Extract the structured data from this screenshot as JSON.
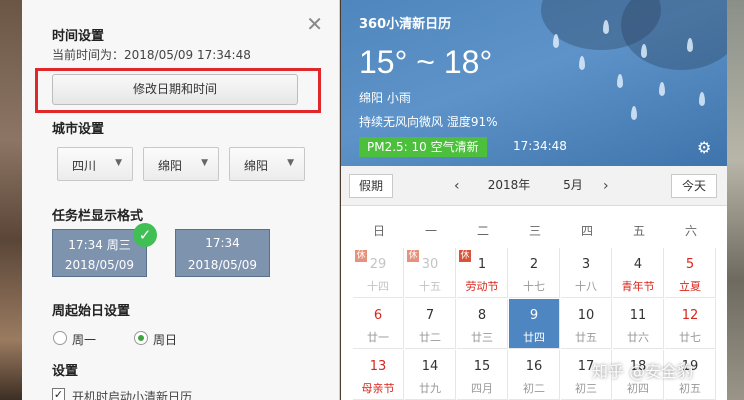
{
  "settings": {
    "time_section_title": "时间设置",
    "current_time_label": "当前时间为：2018/05/09 17:34:48",
    "modify_button": "修改日期和时间",
    "city_section_title": "城市设置",
    "city_selects": [
      "四川",
      "绵阳",
      "绵阳"
    ],
    "taskbar_section_title": "任务栏显示格式",
    "format_options": [
      {
        "line1": "17:34 周三",
        "line2": "2018/05/09",
        "selected": true
      },
      {
        "line1": "17:34",
        "line2": "2018/05/09",
        "selected": false
      }
    ],
    "week_start_title": "周起始日设置",
    "week_start_options": [
      {
        "label": "周一",
        "selected": false
      },
      {
        "label": "周日",
        "selected": true
      }
    ],
    "settings_title": "设置",
    "autostart_label": "开机时启动小清新日历"
  },
  "weather": {
    "app_title": "360小清新日历",
    "temperature": "15° ~ 18°",
    "location_condition": "绵阳 小雨",
    "wind_humidity": "持续无风向微风 湿度91%",
    "pm25": "PM2.5: 10 空气清新",
    "time": "17:34:48"
  },
  "toolbar": {
    "holiday_button": "假期",
    "year": "2018年",
    "month": "5月",
    "today_button": "今天"
  },
  "weekdays": [
    "日",
    "一",
    "二",
    "三",
    "四",
    "五",
    "六"
  ],
  "days": [
    {
      "day": "29",
      "lunar": "十四",
      "dim": true,
      "red": false,
      "tag": "休"
    },
    {
      "day": "30",
      "lunar": "十五",
      "dim": true,
      "red": false,
      "tag": "休"
    },
    {
      "day": "1",
      "lunar": "劳动节",
      "dim": false,
      "red": false,
      "lunar_red": true,
      "tag": "休"
    },
    {
      "day": "2",
      "lunar": "十七",
      "dim": false,
      "red": false
    },
    {
      "day": "3",
      "lunar": "十八",
      "dim": false,
      "red": false
    },
    {
      "day": "4",
      "lunar": "青年节",
      "dim": false,
      "red": false,
      "lunar_red": true
    },
    {
      "day": "5",
      "lunar": "立夏",
      "dim": false,
      "red": true,
      "lunar_red": true
    },
    {
      "day": "6",
      "lunar": "廿一",
      "dim": false,
      "red": true
    },
    {
      "day": "7",
      "lunar": "廿二",
      "dim": false,
      "red": false
    },
    {
      "day": "8",
      "lunar": "廿三",
      "dim": false,
      "red": false
    },
    {
      "day": "9",
      "lunar": "廿四",
      "dim": false,
      "red": false,
      "today": true
    },
    {
      "day": "10",
      "lunar": "廿五",
      "dim": false,
      "red": false
    },
    {
      "day": "11",
      "lunar": "廿六",
      "dim": false,
      "red": false
    },
    {
      "day": "12",
      "lunar": "廿七",
      "dim": false,
      "red": true
    },
    {
      "day": "13",
      "lunar": "母亲节",
      "dim": false,
      "red": true,
      "lunar_red": true
    },
    {
      "day": "14",
      "lunar": "廿九",
      "dim": false,
      "red": false
    },
    {
      "day": "15",
      "lunar": "四月",
      "dim": false,
      "red": false
    },
    {
      "day": "16",
      "lunar": "初二",
      "dim": false,
      "red": false
    },
    {
      "day": "17",
      "lunar": "初三",
      "dim": false,
      "red": false
    },
    {
      "day": "18",
      "lunar": "初四",
      "dim": false,
      "red": false
    },
    {
      "day": "19",
      "lunar": "初五",
      "dim": false,
      "red": false
    }
  ],
  "watermark": "知乎 @安全豹",
  "colors": {
    "accent": "#4e86c2",
    "highlight_box": "#e0282a",
    "pm_badge": "#4cbf3c",
    "holiday_red": "#d9261c"
  }
}
